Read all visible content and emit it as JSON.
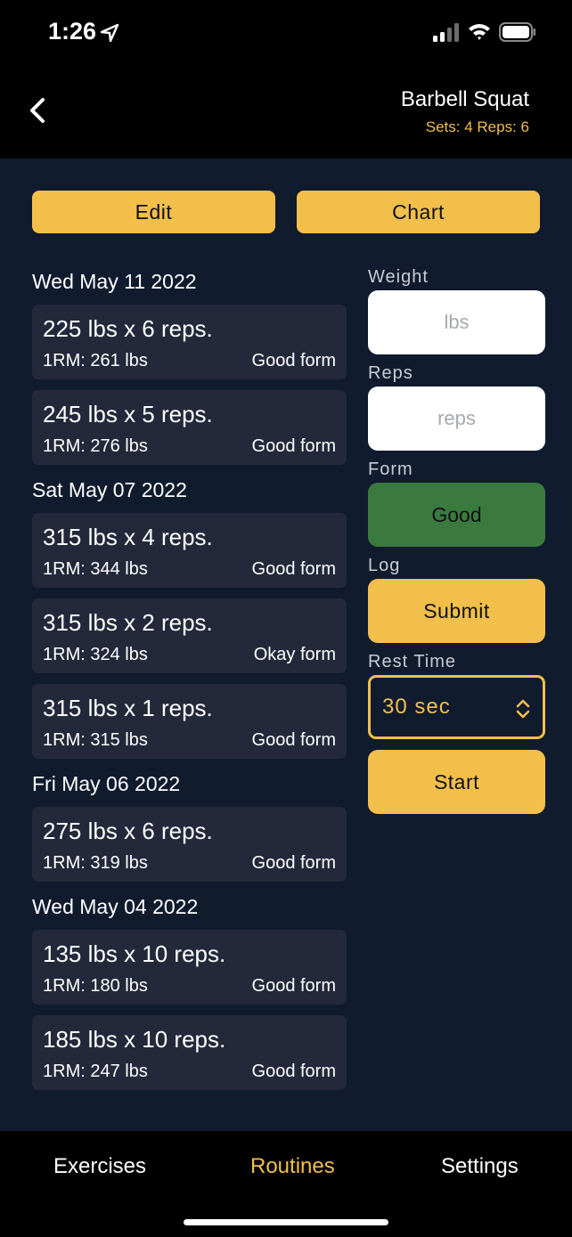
{
  "status_bar": {
    "time": "1:26"
  },
  "header": {
    "title": "Barbell Squat",
    "subtitle": "Sets: 4 Reps: 6"
  },
  "actions": {
    "edit_label": "Edit",
    "chart_label": "Chart"
  },
  "history": [
    {
      "date": "Wed May 11 2022",
      "sets": [
        {
          "main": "225 lbs x 6 reps.",
          "orm": "1RM: 261 lbs",
          "form": "Good form"
        },
        {
          "main": "245 lbs x 5 reps.",
          "orm": "1RM: 276 lbs",
          "form": "Good form"
        }
      ]
    },
    {
      "date": "Sat May 07 2022",
      "sets": [
        {
          "main": "315 lbs x 4 reps.",
          "orm": "1RM: 344 lbs",
          "form": "Good form"
        },
        {
          "main": "315 lbs x 2 reps.",
          "orm": "1RM: 324 lbs",
          "form": "Okay form"
        },
        {
          "main": "315 lbs x 1 reps.",
          "orm": "1RM: 315 lbs",
          "form": "Good form"
        }
      ]
    },
    {
      "date": "Fri May 06 2022",
      "sets": [
        {
          "main": "275 lbs x 6 reps.",
          "orm": "1RM: 319 lbs",
          "form": "Good form"
        }
      ]
    },
    {
      "date": "Wed May 04 2022",
      "sets": [
        {
          "main": "135 lbs x 10 reps.",
          "orm": "1RM: 180 lbs",
          "form": "Good form"
        },
        {
          "main": "185 lbs x 10 reps.",
          "orm": "1RM: 247 lbs",
          "form": "Good form"
        }
      ]
    }
  ],
  "side": {
    "weight_label": "Weight",
    "weight_placeholder": "lbs",
    "reps_label": "Reps",
    "reps_placeholder": "reps",
    "form_label": "Form",
    "form_value": "Good",
    "log_label": "Log",
    "submit_label": "Submit",
    "rest_label": "Rest Time",
    "rest_value": "30 sec",
    "start_label": "Start"
  },
  "tabs": {
    "exercises": "Exercises",
    "routines": "Routines",
    "settings": "Settings"
  },
  "colors": {
    "accent": "#f2bf4b",
    "background": "#111b2e",
    "card": "#23293a",
    "form_good": "#3a7a3e"
  },
  "icons": [
    "location-arrow-icon",
    "signal-icon",
    "wifi-icon",
    "battery-icon",
    "back-chevron-icon",
    "up-down-chevron-icon"
  ]
}
